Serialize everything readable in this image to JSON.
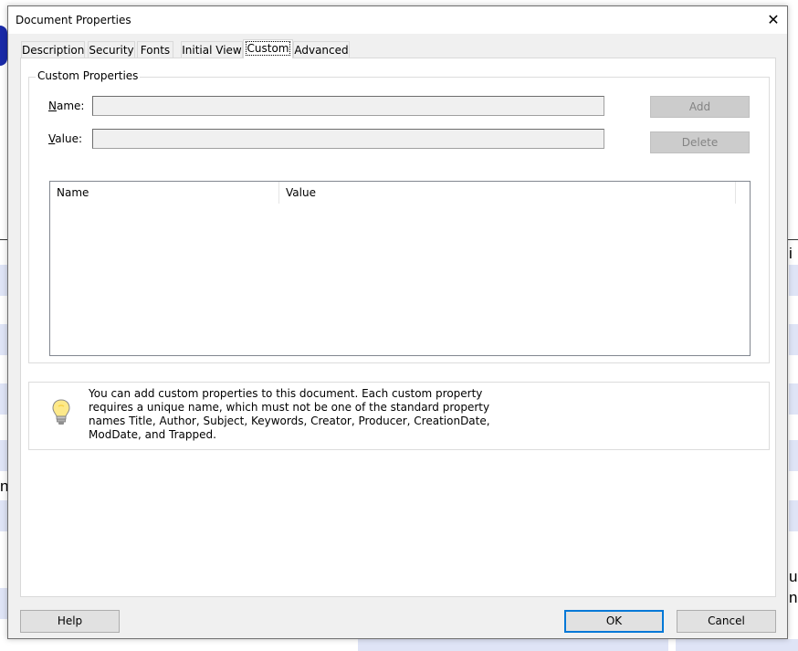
{
  "background": {
    "fragments": [
      "i",
      "n",
      "uk",
      "na"
    ]
  },
  "dialog": {
    "title": "Document Properties",
    "close_glyph": "✕"
  },
  "tabs": [
    {
      "label": "Description",
      "active": false
    },
    {
      "label": "Security",
      "active": false
    },
    {
      "label": "Fonts",
      "active": false
    },
    {
      "label": "Initial View",
      "active": false
    },
    {
      "label": "Custom",
      "active": true
    },
    {
      "label": "Advanced",
      "active": false
    }
  ],
  "custom": {
    "group_label": "Custom Properties",
    "name_label_accel": "N",
    "name_label_rest": "ame:",
    "value_label_accel": "V",
    "value_label_rest": "alue:",
    "name_value": "",
    "value_value": "",
    "add_label": "Add",
    "delete_label": "Delete",
    "columns": [
      "Name",
      "Value"
    ],
    "rows": []
  },
  "info": {
    "icon": "lightbulb-icon",
    "text": "You can add custom properties to this document. Each custom property requires a unique name, which must not be one of the standard property names Title, Author, Subject, Keywords, Creator, Producer, CreationDate, ModDate, and Trapped."
  },
  "footer": {
    "help_label": "Help",
    "ok_label": "OK",
    "cancel_label": "Cancel"
  },
  "colors": {
    "accent": "#0078d7",
    "background_stripe": "#dfe4f6",
    "dialog_bg": "#f0f0f0"
  }
}
